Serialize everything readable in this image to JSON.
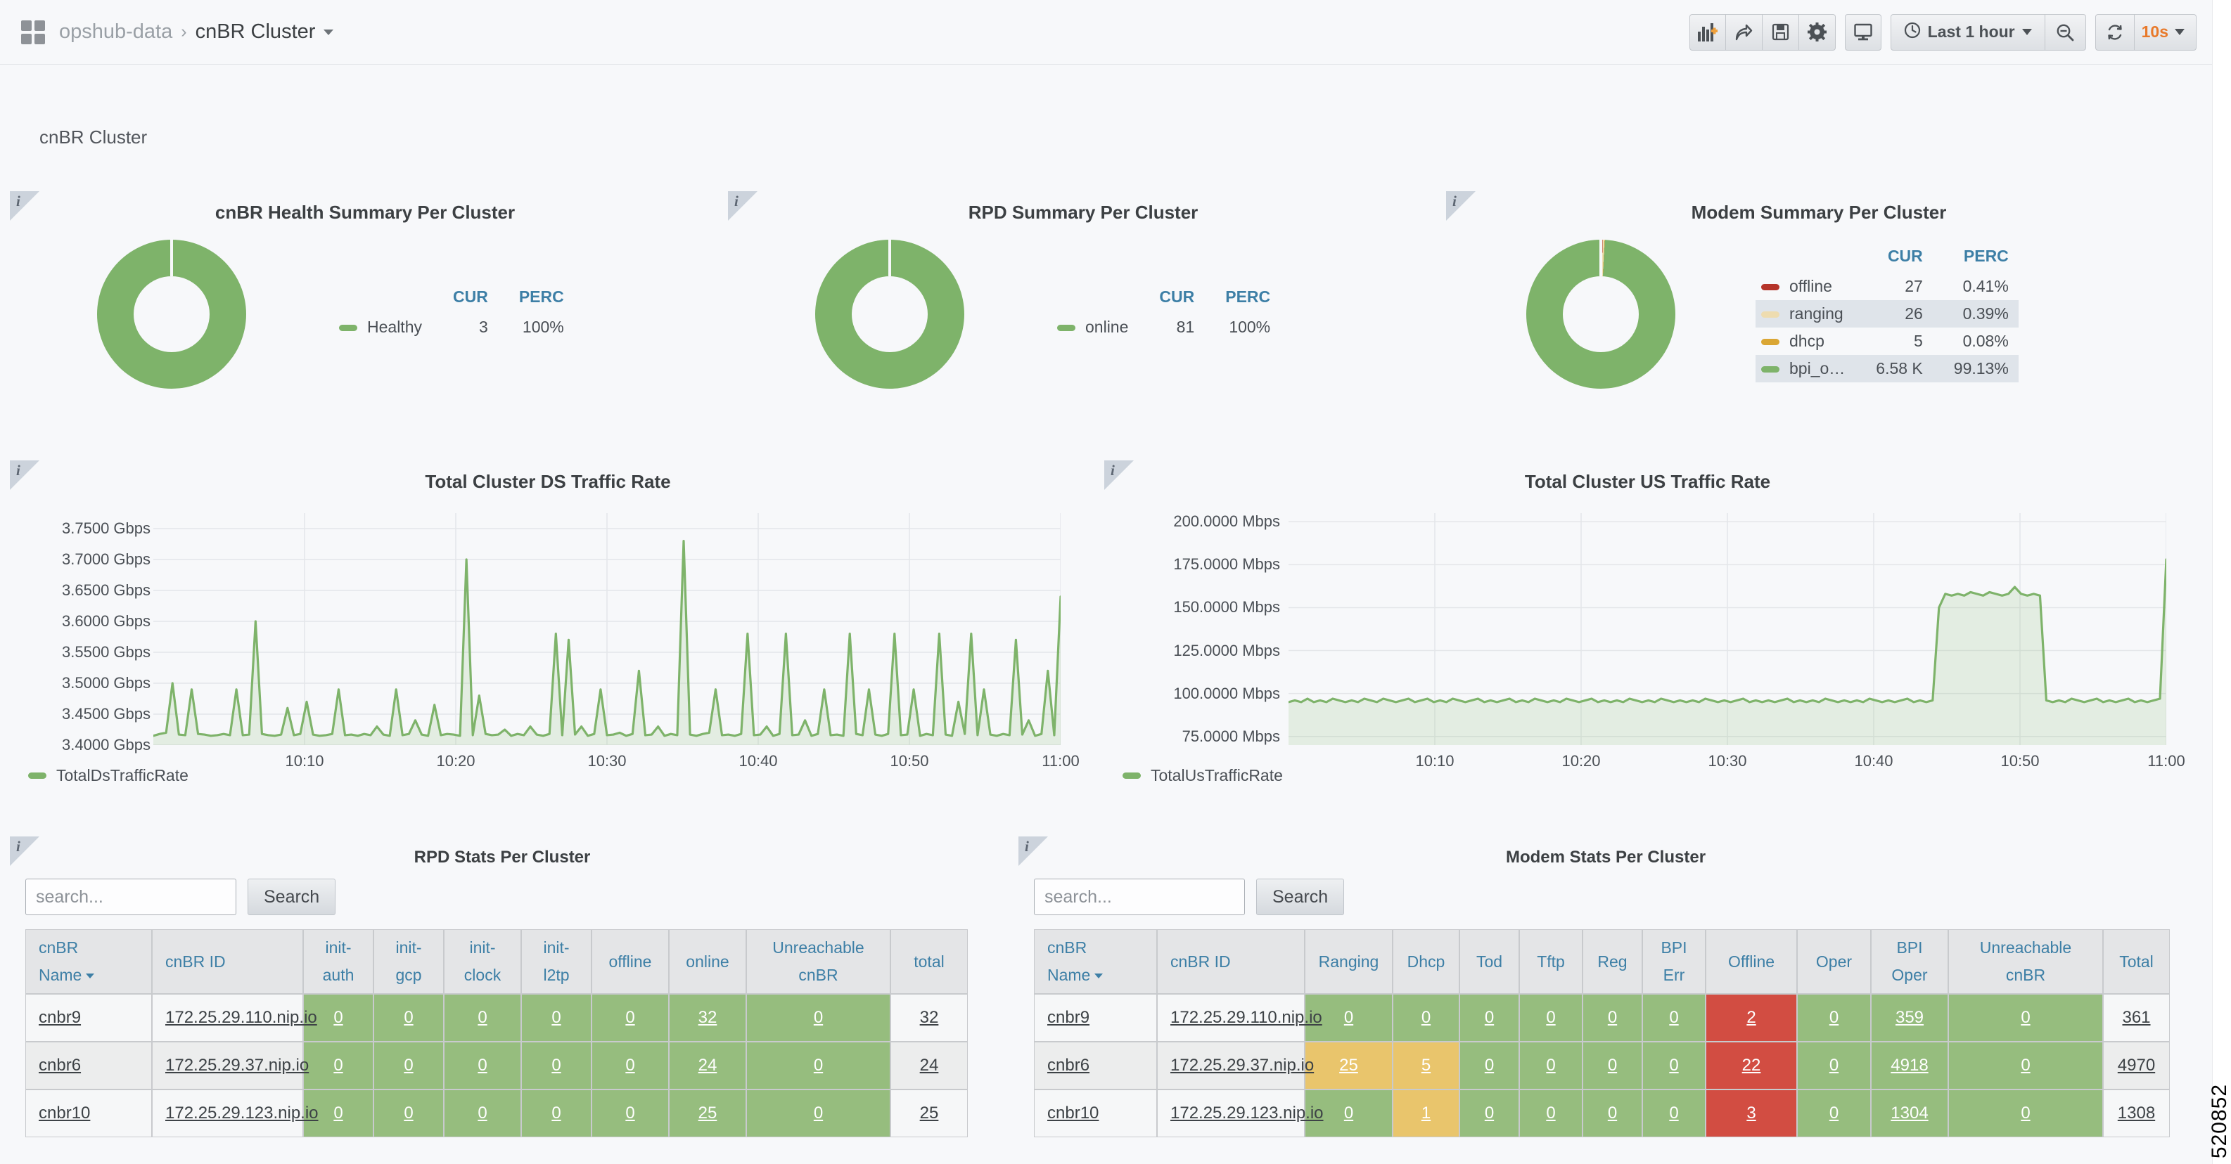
{
  "nav": {
    "folder": "opshub-data",
    "separator": "›",
    "dashboard_title": "cnBR Cluster",
    "buttons": [
      {
        "name": "add-panel-icon",
        "label": "add-panel"
      },
      {
        "name": "share-icon",
        "label": "share"
      },
      {
        "name": "save-icon",
        "label": "save"
      },
      {
        "name": "settings-gear-icon",
        "label": "settings"
      },
      {
        "name": "tv-mode-icon",
        "label": "cycle-view-mode"
      }
    ],
    "time_range": "Last 1 hour",
    "zoom_out_label": "zoom-out",
    "refresh_interval": "10s"
  },
  "row": {
    "title": "cnBR Cluster"
  },
  "panels": {
    "cnbr_health": {
      "title": "cnBR Health Summary Per Cluster",
      "info_glyph": "i",
      "legend_headers": [
        "CUR",
        "PERC"
      ],
      "series": [
        {
          "label": "Healthy",
          "color": "#7eb36a",
          "cur": "3",
          "perc": "100%",
          "fraction": 1.0
        }
      ]
    },
    "rpd_summary": {
      "title": "RPD Summary Per Cluster",
      "info_glyph": "i",
      "legend_headers": [
        "CUR",
        "PERC"
      ],
      "series": [
        {
          "label": "online",
          "color": "#7eb36a",
          "cur": "81",
          "perc": "100%",
          "fraction": 1.0
        }
      ]
    },
    "modem_summary": {
      "title": "Modem Summary Per Cluster",
      "info_glyph": "i",
      "legend_headers": [
        "CUR",
        "PERC"
      ],
      "series": [
        {
          "label": "offline",
          "color": "#b5342a",
          "cur": "27",
          "perc": "0.41%",
          "fraction": 0.0041
        },
        {
          "label": "ranging",
          "color": "#eedcb0",
          "cur": "26",
          "perc": "0.39%",
          "fraction": 0.0039
        },
        {
          "label": "dhcp",
          "color": "#daa634",
          "cur": "5",
          "perc": "0.08%",
          "fraction": 0.0008
        },
        {
          "label": "bpi_o…",
          "color": "#7eb36a",
          "cur": "6.58 K",
          "perc": "99.13%",
          "fraction": 0.9913
        }
      ]
    },
    "ds_traffic": {
      "title": "Total Cluster DS Traffic Rate",
      "info_glyph": "i",
      "legend_label": "TotalDsTrafficRate",
      "legend_color": "#7eb36a"
    },
    "us_traffic": {
      "title": "Total Cluster US Traffic Rate",
      "info_glyph": "i",
      "legend_label": "TotalUsTrafficRate",
      "legend_color": "#7eb36a"
    },
    "rpd_stats": {
      "title": "RPD Stats Per Cluster",
      "info_glyph": "i",
      "search_placeholder": "search...",
      "search_value": "",
      "search_button": "Search",
      "columns": [
        "cnBR Name",
        "cnBR ID",
        "init-auth",
        "init-gcp",
        "init-clock",
        "init-l2tp",
        "offline",
        "online",
        "Unreachable cnBR",
        "total"
      ],
      "sort_column": "cnBR Name",
      "rows": [
        {
          "cells": [
            {
              "v": "cnbr9",
              "style": "name"
            },
            {
              "v": "172.25.29.110.nip.io",
              "style": "name"
            },
            {
              "v": "0",
              "style": "green"
            },
            {
              "v": "0",
              "style": "green"
            },
            {
              "v": "0",
              "style": "green"
            },
            {
              "v": "0",
              "style": "green"
            },
            {
              "v": "0",
              "style": "green"
            },
            {
              "v": "32",
              "style": "green"
            },
            {
              "v": "0",
              "style": "green"
            },
            {
              "v": "32",
              "style": "plain"
            }
          ]
        },
        {
          "cells": [
            {
              "v": "cnbr6",
              "style": "name"
            },
            {
              "v": "172.25.29.37.nip.io",
              "style": "name"
            },
            {
              "v": "0",
              "style": "green"
            },
            {
              "v": "0",
              "style": "green"
            },
            {
              "v": "0",
              "style": "green"
            },
            {
              "v": "0",
              "style": "green"
            },
            {
              "v": "0",
              "style": "green"
            },
            {
              "v": "24",
              "style": "green"
            },
            {
              "v": "0",
              "style": "green"
            },
            {
              "v": "24",
              "style": "plain"
            }
          ]
        },
        {
          "cells": [
            {
              "v": "cnbr10",
              "style": "name"
            },
            {
              "v": "172.25.29.123.nip.io",
              "style": "name"
            },
            {
              "v": "0",
              "style": "green"
            },
            {
              "v": "0",
              "style": "green"
            },
            {
              "v": "0",
              "style": "green"
            },
            {
              "v": "0",
              "style": "green"
            },
            {
              "v": "0",
              "style": "green"
            },
            {
              "v": "25",
              "style": "green"
            },
            {
              "v": "0",
              "style": "green"
            },
            {
              "v": "25",
              "style": "plain"
            }
          ]
        }
      ]
    },
    "modem_stats": {
      "title": "Modem Stats Per Cluster",
      "info_glyph": "i",
      "search_placeholder": "search...",
      "search_value": "",
      "search_button": "Search",
      "columns": [
        "cnBR Name",
        "cnBR ID",
        "Ranging",
        "Dhcp",
        "Tod",
        "Tftp",
        "Reg",
        "BPI Err",
        "Offline",
        "Oper",
        "BPI Oper",
        "Unreachable cnBR",
        "Total"
      ],
      "sort_column": "cnBR Name",
      "rows": [
        {
          "cells": [
            {
              "v": "cnbr9",
              "style": "name"
            },
            {
              "v": "172.25.29.110.nip.io",
              "style": "name"
            },
            {
              "v": "0",
              "style": "green"
            },
            {
              "v": "0",
              "style": "green"
            },
            {
              "v": "0",
              "style": "green"
            },
            {
              "v": "0",
              "style": "green"
            },
            {
              "v": "0",
              "style": "green"
            },
            {
              "v": "0",
              "style": "green"
            },
            {
              "v": "2",
              "style": "red"
            },
            {
              "v": "0",
              "style": "green"
            },
            {
              "v": "359",
              "style": "green"
            },
            {
              "v": "0",
              "style": "green"
            },
            {
              "v": "361",
              "style": "plain"
            }
          ]
        },
        {
          "cells": [
            {
              "v": "cnbr6",
              "style": "name"
            },
            {
              "v": "172.25.29.37.nip.io",
              "style": "name"
            },
            {
              "v": "25",
              "style": "yellow"
            },
            {
              "v": "5",
              "style": "yellow"
            },
            {
              "v": "0",
              "style": "green"
            },
            {
              "v": "0",
              "style": "green"
            },
            {
              "v": "0",
              "style": "green"
            },
            {
              "v": "0",
              "style": "green"
            },
            {
              "v": "22",
              "style": "red"
            },
            {
              "v": "0",
              "style": "green"
            },
            {
              "v": "4918",
              "style": "green"
            },
            {
              "v": "0",
              "style": "green"
            },
            {
              "v": "4970",
              "style": "plain"
            }
          ]
        },
        {
          "cells": [
            {
              "v": "cnbr10",
              "style": "name"
            },
            {
              "v": "172.25.29.123.nip.io",
              "style": "name"
            },
            {
              "v": "0",
              "style": "green"
            },
            {
              "v": "1",
              "style": "yellow"
            },
            {
              "v": "0",
              "style": "green"
            },
            {
              "v": "0",
              "style": "green"
            },
            {
              "v": "0",
              "style": "green"
            },
            {
              "v": "0",
              "style": "green"
            },
            {
              "v": "3",
              "style": "red"
            },
            {
              "v": "0",
              "style": "green"
            },
            {
              "v": "1304",
              "style": "green"
            },
            {
              "v": "0",
              "style": "green"
            },
            {
              "v": "1308",
              "style": "plain"
            }
          ]
        }
      ]
    }
  },
  "page_marker": "520852",
  "chart_data": [
    {
      "type": "line",
      "id": "ds_traffic",
      "title": "Total Cluster DS Traffic Rate",
      "xlabel": "",
      "ylabel": "",
      "unit": "Gbps",
      "ylim": [
        3.4,
        3.775
      ],
      "yticks": [
        "3.4000 Gbps",
        "3.4500 Gbps",
        "3.5000 Gbps",
        "3.5500 Gbps",
        "3.6000 Gbps",
        "3.6500 Gbps",
        "3.7000 Gbps",
        "3.7500 Gbps"
      ],
      "ytick_values": [
        3.4,
        3.45,
        3.5,
        3.55,
        3.6,
        3.65,
        3.7,
        3.75
      ],
      "xticks": [
        "10:10",
        "10:20",
        "10:30",
        "10:40",
        "10:50",
        "11:00"
      ],
      "grid": true,
      "legend_position": "bottom-left",
      "series": [
        {
          "name": "TotalDsTrafficRate",
          "color": "#7eb36a",
          "baseline": 3.415,
          "values": [
            3.415,
            3.418,
            3.42,
            3.5,
            3.417,
            3.416,
            3.49,
            3.418,
            3.417,
            3.415,
            3.416,
            3.418,
            3.416,
            3.49,
            3.416,
            3.417,
            3.6,
            3.418,
            3.416,
            3.415,
            3.417,
            3.46,
            3.416,
            3.418,
            3.47,
            3.417,
            3.415,
            3.416,
            3.418,
            3.49,
            3.416,
            3.417,
            3.415,
            3.418,
            3.416,
            3.43,
            3.417,
            3.415,
            3.49,
            3.416,
            3.418,
            3.44,
            3.417,
            3.415,
            3.465,
            3.416,
            3.418,
            3.417,
            3.415,
            3.7,
            3.416,
            3.48,
            3.418,
            3.416,
            3.417,
            3.425,
            3.415,
            3.418,
            3.416,
            3.43,
            3.417,
            3.415,
            3.418,
            3.58,
            3.416,
            3.57,
            3.417,
            3.43,
            3.415,
            3.418,
            3.49,
            3.416,
            3.417,
            3.42,
            3.415,
            3.418,
            3.52,
            3.416,
            3.417,
            3.43,
            3.415,
            3.418,
            3.416,
            3.73,
            3.417,
            3.415,
            3.418,
            3.42,
            3.49,
            3.416,
            3.417,
            3.415,
            3.418,
            3.58,
            3.416,
            3.417,
            3.43,
            3.415,
            3.418,
            3.58,
            3.416,
            3.417,
            3.44,
            3.415,
            3.418,
            3.49,
            3.416,
            3.417,
            3.415,
            3.58,
            3.418,
            3.416,
            3.49,
            3.417,
            3.415,
            3.418,
            3.58,
            3.416,
            3.417,
            3.49,
            3.415,
            3.418,
            3.416,
            3.58,
            3.417,
            3.415,
            3.47,
            3.418,
            3.58,
            3.416,
            3.49,
            3.417,
            3.415,
            3.418,
            3.416,
            3.57,
            3.417,
            3.44,
            3.415,
            3.418,
            3.52,
            3.416,
            3.64
          ]
        }
      ]
    },
    {
      "type": "area",
      "id": "us_traffic",
      "title": "Total Cluster US Traffic Rate",
      "xlabel": "",
      "ylabel": "",
      "unit": "Mbps",
      "ylim": [
        70,
        205
      ],
      "yticks": [
        "75.0000 Mbps",
        "100.0000 Mbps",
        "125.0000 Mbps",
        "150.0000 Mbps",
        "175.0000 Mbps",
        "200.0000 Mbps"
      ],
      "ytick_values": [
        75,
        100,
        125,
        150,
        175,
        200
      ],
      "xticks": [
        "10:10",
        "10:20",
        "10:30",
        "10:40",
        "10:50",
        "11:00"
      ],
      "grid": true,
      "legend_position": "bottom-left",
      "series": [
        {
          "name": "TotalUsTrafficRate",
          "color": "#7eb36a",
          "values": [
            95,
            96,
            95,
            97,
            95,
            96,
            95,
            97,
            96,
            95,
            96,
            95,
            97,
            96,
            95,
            97,
            96,
            95,
            96,
            97,
            95,
            96,
            97,
            95,
            96,
            95,
            97,
            96,
            95,
            96,
            97,
            95,
            96,
            95,
            96,
            97,
            95,
            96,
            95,
            97,
            96,
            95,
            96,
            95,
            97,
            96,
            95,
            96,
            97,
            95,
            96,
            95,
            96,
            95,
            97,
            96,
            95,
            96,
            95,
            97,
            96,
            95,
            96,
            95,
            96,
            95,
            97,
            96,
            95,
            96,
            95,
            96,
            97,
            95,
            96,
            95,
            96,
            95,
            96,
            97,
            95,
            96,
            95,
            96,
            95,
            97,
            96,
            95,
            96,
            95,
            96,
            95,
            97,
            96,
            95,
            96,
            95,
            96,
            97,
            95,
            96,
            95,
            96,
            150,
            158,
            157,
            158,
            157,
            159,
            158,
            157,
            159,
            158,
            157,
            158,
            162,
            158,
            157,
            158,
            157,
            96,
            95,
            96,
            95,
            97,
            96,
            95,
            96,
            97,
            95,
            96,
            95,
            96,
            97,
            95,
            96,
            95,
            96,
            97,
            178
          ]
        }
      ]
    }
  ]
}
